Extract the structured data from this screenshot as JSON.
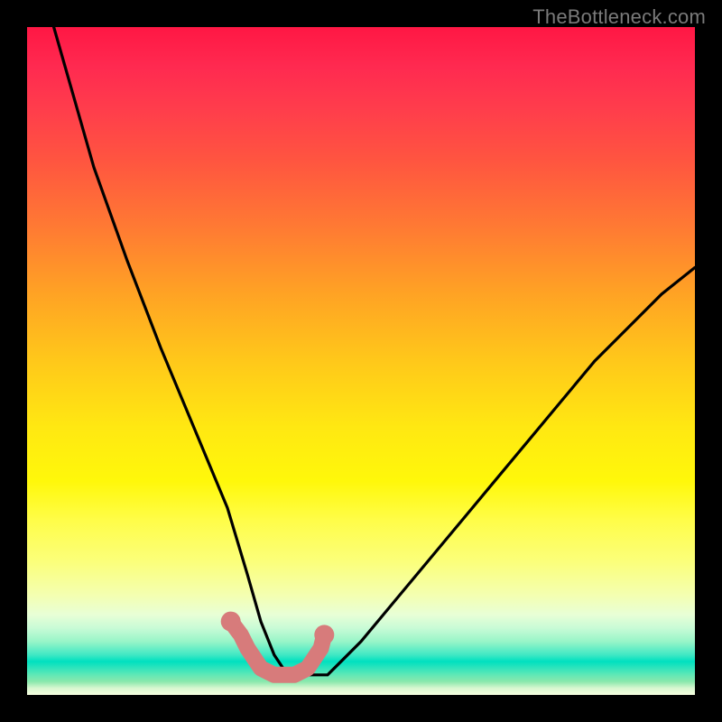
{
  "attribution": "TheBottleneck.com",
  "chart_data": {
    "type": "line",
    "title": "",
    "xlabel": "",
    "ylabel": "",
    "xlim": [
      0,
      100
    ],
    "ylim": [
      0,
      100
    ],
    "series": [
      {
        "name": "curve",
        "x": [
          4,
          10,
          15,
          20,
          25,
          30,
          33,
          35,
          37,
          39,
          40,
          45,
          50,
          55,
          60,
          65,
          70,
          75,
          80,
          85,
          90,
          95,
          100
        ],
        "values": [
          100,
          79,
          65,
          52,
          40,
          28,
          18,
          11,
          6,
          3,
          3,
          3,
          8,
          14,
          20,
          26,
          32,
          38,
          44,
          50,
          55,
          60,
          64
        ]
      }
    ],
    "accent_segment": {
      "note": "pink thick stroke with dot-endpoints near the trough",
      "x": [
        30.5,
        32,
        33,
        35,
        37,
        39,
        40,
        42,
        44,
        44.5
      ],
      "values": [
        11,
        9,
        7,
        4,
        3,
        3,
        3,
        4,
        7,
        9
      ]
    },
    "colors": {
      "curve": "#000000",
      "accent": "#d77b7b"
    }
  }
}
